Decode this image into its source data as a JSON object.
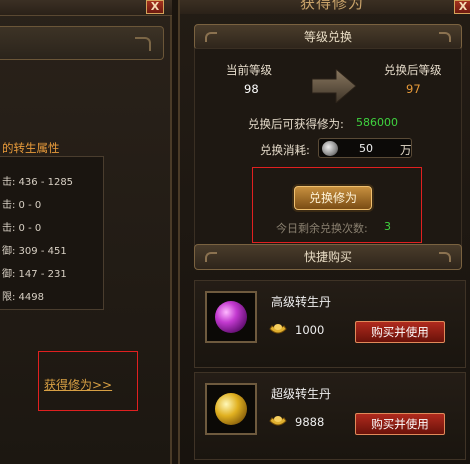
{
  "left": {
    "close_label": "X",
    "section_title": "的转生属性",
    "stats": [
      "击: 436 - 1285",
      "击: 0 - 0",
      "击: 0 - 0",
      "御: 309 - 451",
      "御: 147 - 231",
      "限: 4498"
    ],
    "link": "获得修为>>"
  },
  "right": {
    "title": "获得修为",
    "close_label": "X",
    "exchange": {
      "header": "等级兑换",
      "current_label": "当前等级",
      "current_value": "98",
      "after_label": "兑换后等级",
      "after_value": "97",
      "gain_label": "兑换后可获得修为:",
      "gain_value": "586000",
      "cost_label": "兑换消耗:",
      "cost_value": "50",
      "cost_unit": "万",
      "button": "兑换修为",
      "remain_label": "今日剩余兑换次数:",
      "remain_value": "3"
    },
    "shop": {
      "header": "快捷购买",
      "items": [
        {
          "name": "高级转生丹",
          "price": "1000",
          "button": "购买并使用"
        },
        {
          "name": "超级转生丹",
          "price": "9888",
          "button": "购买并使用"
        }
      ]
    }
  },
  "colors": {
    "accent_green": "#3fd23f",
    "accent_orange": "#e79a3a",
    "highlight_red": "#e02020"
  }
}
